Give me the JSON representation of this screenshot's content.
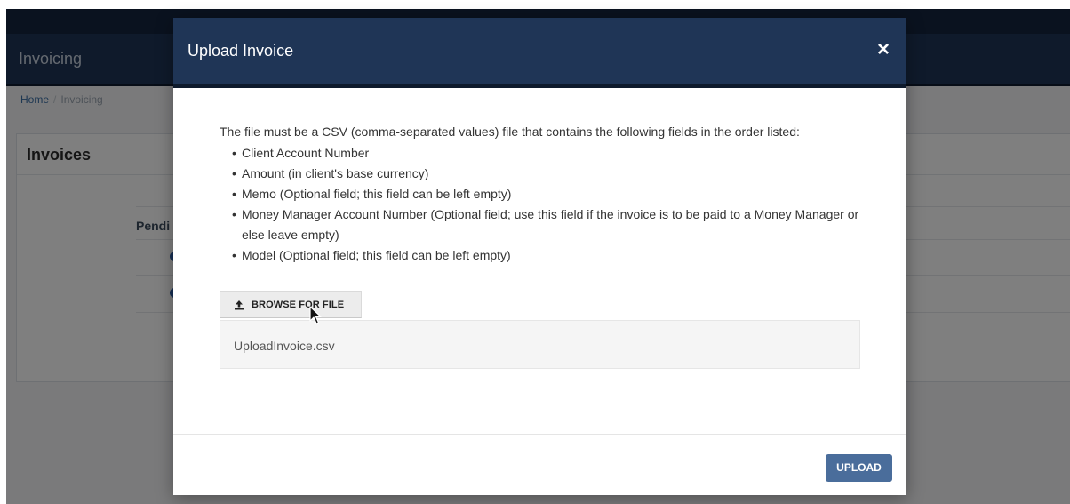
{
  "app": {
    "title": "Invoicing",
    "breadcrumb": {
      "home": "Home",
      "separator": "/",
      "current": "Invoicing"
    },
    "panel_title": "Invoices",
    "table_header_partial": "Pendi"
  },
  "modal": {
    "title": "Upload Invoice",
    "close_glyph": "×",
    "intro": "The file must be a CSV (comma-separated values) file that contains the following fields in the order listed:",
    "fields": [
      "Client Account Number",
      "Amount (in client's base currency)",
      "Memo (Optional field; this field can be left empty)",
      "Money Manager Account Number (Optional field; use this field if the invoice is to be paid to a Money Manager or else leave empty)",
      "Model (Optional field; this field can be left empty)"
    ],
    "browse_label": "BROWSE FOR FILE",
    "browse_icon": "upload-icon",
    "selected_file": "UploadInvoice.csv",
    "upload_label": "UPLOAD"
  },
  "colors": {
    "header_navy": "#1f3556",
    "upload_button": "#4a6d9b"
  }
}
